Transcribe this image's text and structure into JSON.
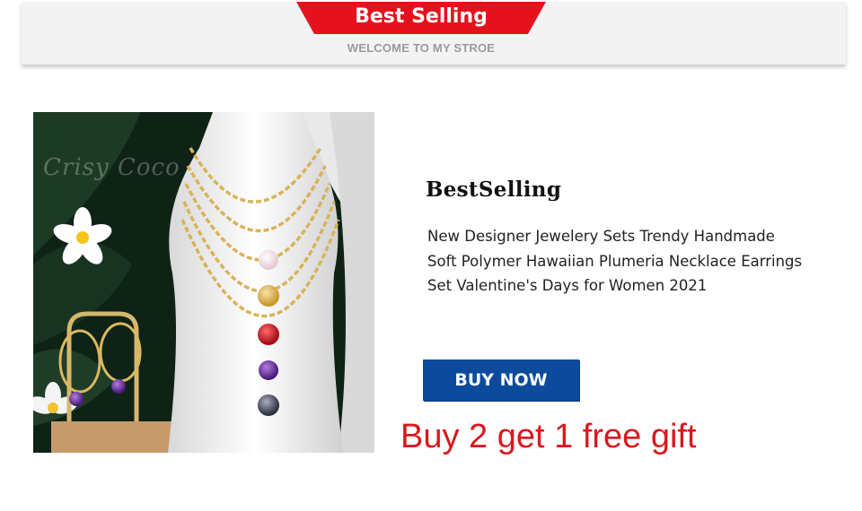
{
  "header": {
    "title": "Best Selling",
    "subtitle": "WELCOME TO MY STROE",
    "ribbon_color": "#e5121d"
  },
  "product": {
    "image_watermark": "Crisy Coco",
    "heading": "BestSelling",
    "description_lines": [
      "New Designer Jewelery Sets Trendy Handmade",
      "Soft Polymer Hawaiian Plumeria Necklace Earrings",
      "Set Valentine's Days for Women 2021"
    ],
    "buy_button_label": "BUY NOW",
    "buy_button_color": "#0c4b9c",
    "promo_text": "Buy 2 get 1 free gift",
    "promo_color": "#d8191d"
  }
}
